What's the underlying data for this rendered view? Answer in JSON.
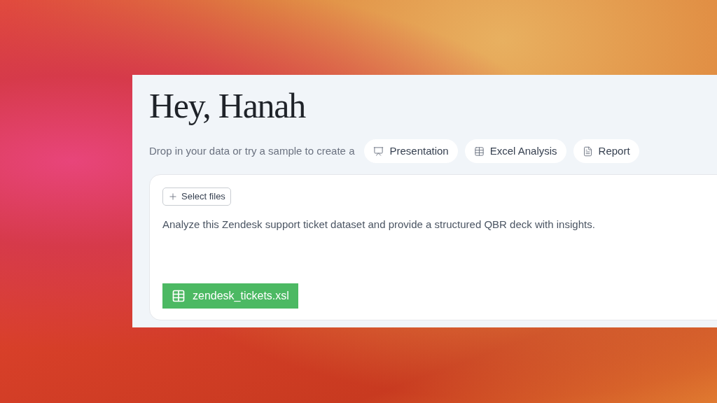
{
  "greeting": "Hey, Hanah",
  "samples": {
    "intro": "Drop in your data or try a sample to create a",
    "options": [
      {
        "kind": "presentation",
        "label": "Presentation"
      },
      {
        "kind": "spreadsheet",
        "label": "Excel Analysis"
      },
      {
        "kind": "document",
        "label": "Report"
      }
    ]
  },
  "composer": {
    "select_files": "Select files",
    "prompt": "Analyze this Zendesk support ticket dataset and provide a structured QBR deck with insights.",
    "attachment": "zendesk_tickets.xsl"
  }
}
